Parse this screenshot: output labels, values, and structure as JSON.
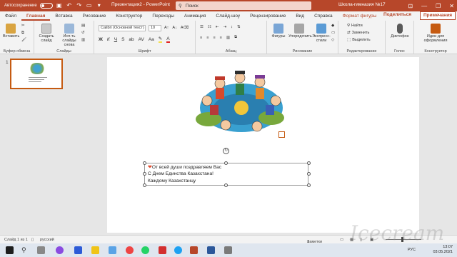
{
  "titlebar": {
    "autosave_label": "Автосохранение",
    "autosave_state": "off",
    "doc_title": "Презентация2 - PowerPoint",
    "search_placeholder": "Поиск",
    "account": "Школа-гимназия №17",
    "accent": "#b7472a"
  },
  "tabs": [
    "Файл",
    "Главная",
    "Вставка",
    "Рисование",
    "Конструктор",
    "Переходы",
    "Анимация",
    "Слайд-шоу",
    "Рецензирование",
    "Вид",
    "Справка",
    "Формат фигуры"
  ],
  "active_tab": "Главная",
  "share_label": "Поделиться",
  "notes_label": "Примечания",
  "ribbon": {
    "clipboard": {
      "paste": "Вставить",
      "label": "Буфер обмена"
    },
    "slides": {
      "new_slide": "Создать слайд",
      "reuse": "Исп-ть слайды снова",
      "label": "Слайды"
    },
    "font": {
      "name": "Calibri (Основной текст)",
      "size": "10",
      "label": "Шрифт"
    },
    "paragraph": {
      "label": "Абзац"
    },
    "drawing": {
      "shapes": "Фигуры",
      "arrange": "Упорядочить",
      "styles": "Экспресс-стили",
      "label": "Рисование"
    },
    "editing": {
      "find": "Найти",
      "replace": "Заменить",
      "select": "Выделить",
      "label": "Редактирование"
    },
    "voice": {
      "dictate": "Диктофон",
      "label": "Голос"
    },
    "designer": {
      "ideas": "Идеи для оформления",
      "label": "Конструктор"
    }
  },
  "thumbnail": {
    "number": "1"
  },
  "slide": {
    "lines": [
      "От всей души поздравляем Вас",
      "С Днем Единства Казахстана!",
      "Каждому Казахстанцу"
    ]
  },
  "status": {
    "slide_info": "Слайд 1 из 1",
    "language": "русский",
    "notes": "Заметки"
  },
  "taskbar": {
    "time": "13:07",
    "date": "03.05.2021",
    "lang": "РУС"
  },
  "watermark": "Icecream"
}
